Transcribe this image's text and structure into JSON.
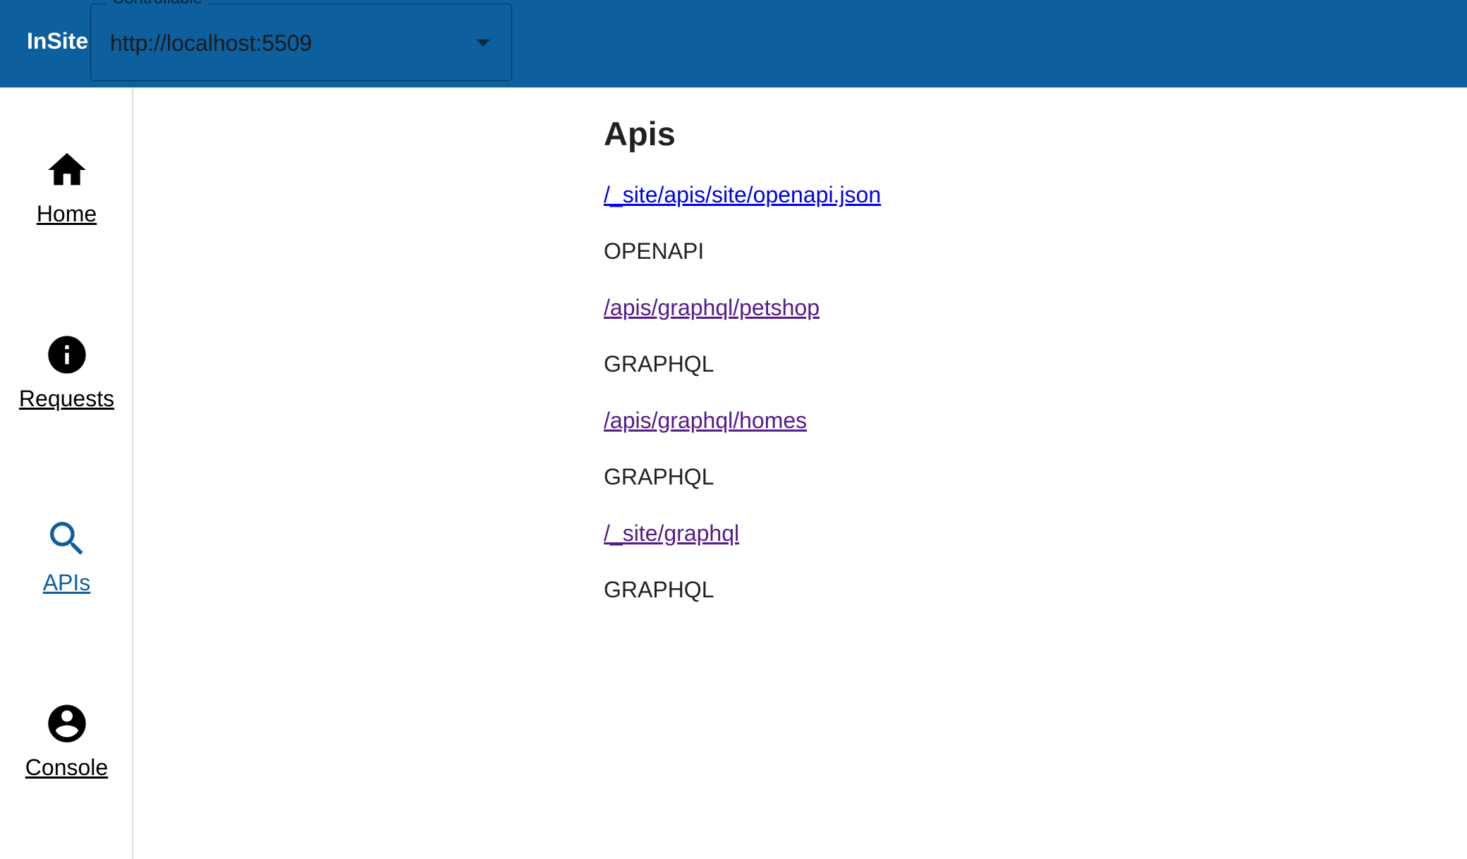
{
  "app": {
    "title": "InSite"
  },
  "select": {
    "label": "Controllable",
    "value": "http://localhost:5509"
  },
  "nav": [
    {
      "label": "Home",
      "icon": "home-icon",
      "active": false
    },
    {
      "label": "Requests",
      "icon": "info-icon",
      "active": false
    },
    {
      "label": "APIs",
      "icon": "search-icon",
      "active": true
    },
    {
      "label": "Console",
      "icon": "account-circle-icon",
      "active": false
    }
  ],
  "page": {
    "title": "Apis",
    "apis": [
      {
        "path": "/_site/apis/site/openapi.json",
        "type": "OPENAPI"
      },
      {
        "path": "/apis/graphql/petshop",
        "type": "GRAPHQL"
      },
      {
        "path": "/apis/graphql/homes",
        "type": "GRAPHQL"
      },
      {
        "path": "/_site/graphql",
        "type": "GRAPHQL"
      }
    ]
  },
  "colors": {
    "appbar": "#0d5f9e",
    "link_unvisited": "#0000ee",
    "link_visited": "#551a8b",
    "nav_active": "#0d5f9e"
  }
}
